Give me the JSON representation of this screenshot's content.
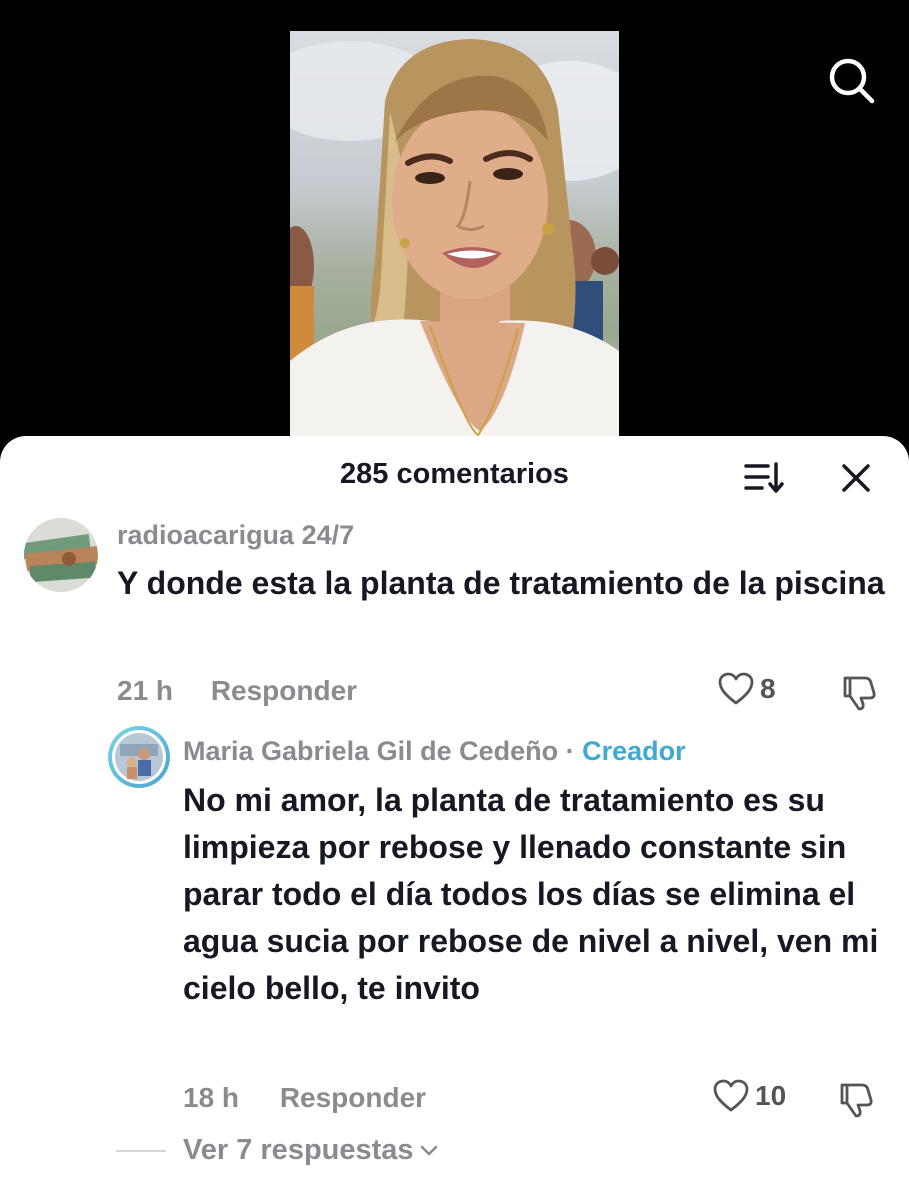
{
  "video": {
    "search_icon": "search-icon"
  },
  "comments_header": {
    "title": "285 comentarios",
    "sort_icon": "sort-icon",
    "close_icon": "close-icon"
  },
  "comments": [
    {
      "username": "radioacarigua 24/7",
      "text": "Y donde esta la planta de tratamiento de la piscina",
      "time": "21 h",
      "reply_label": "Responder",
      "likes": "8"
    },
    {
      "username": "Maria Gabriela Gil de Cedeño",
      "separator": " · ",
      "badge": "Creador",
      "text": "No mi amor, la planta de tratamiento es su limpieza por rebose y llenado constante sin parar todo el día todos los días se elimina el agua sucia por rebose de nivel a nivel, ven mi cielo bello, te invito",
      "time": "18 h",
      "reply_label": "Responder",
      "likes": "10",
      "view_replies": "Ver 7 respuestas"
    }
  ],
  "colors": {
    "text_primary": "#161823",
    "text_secondary": "#8a8b91",
    "creator_accent": "#3fa9d3",
    "sheet_bg": "#ffffff",
    "video_bg": "#000000"
  }
}
